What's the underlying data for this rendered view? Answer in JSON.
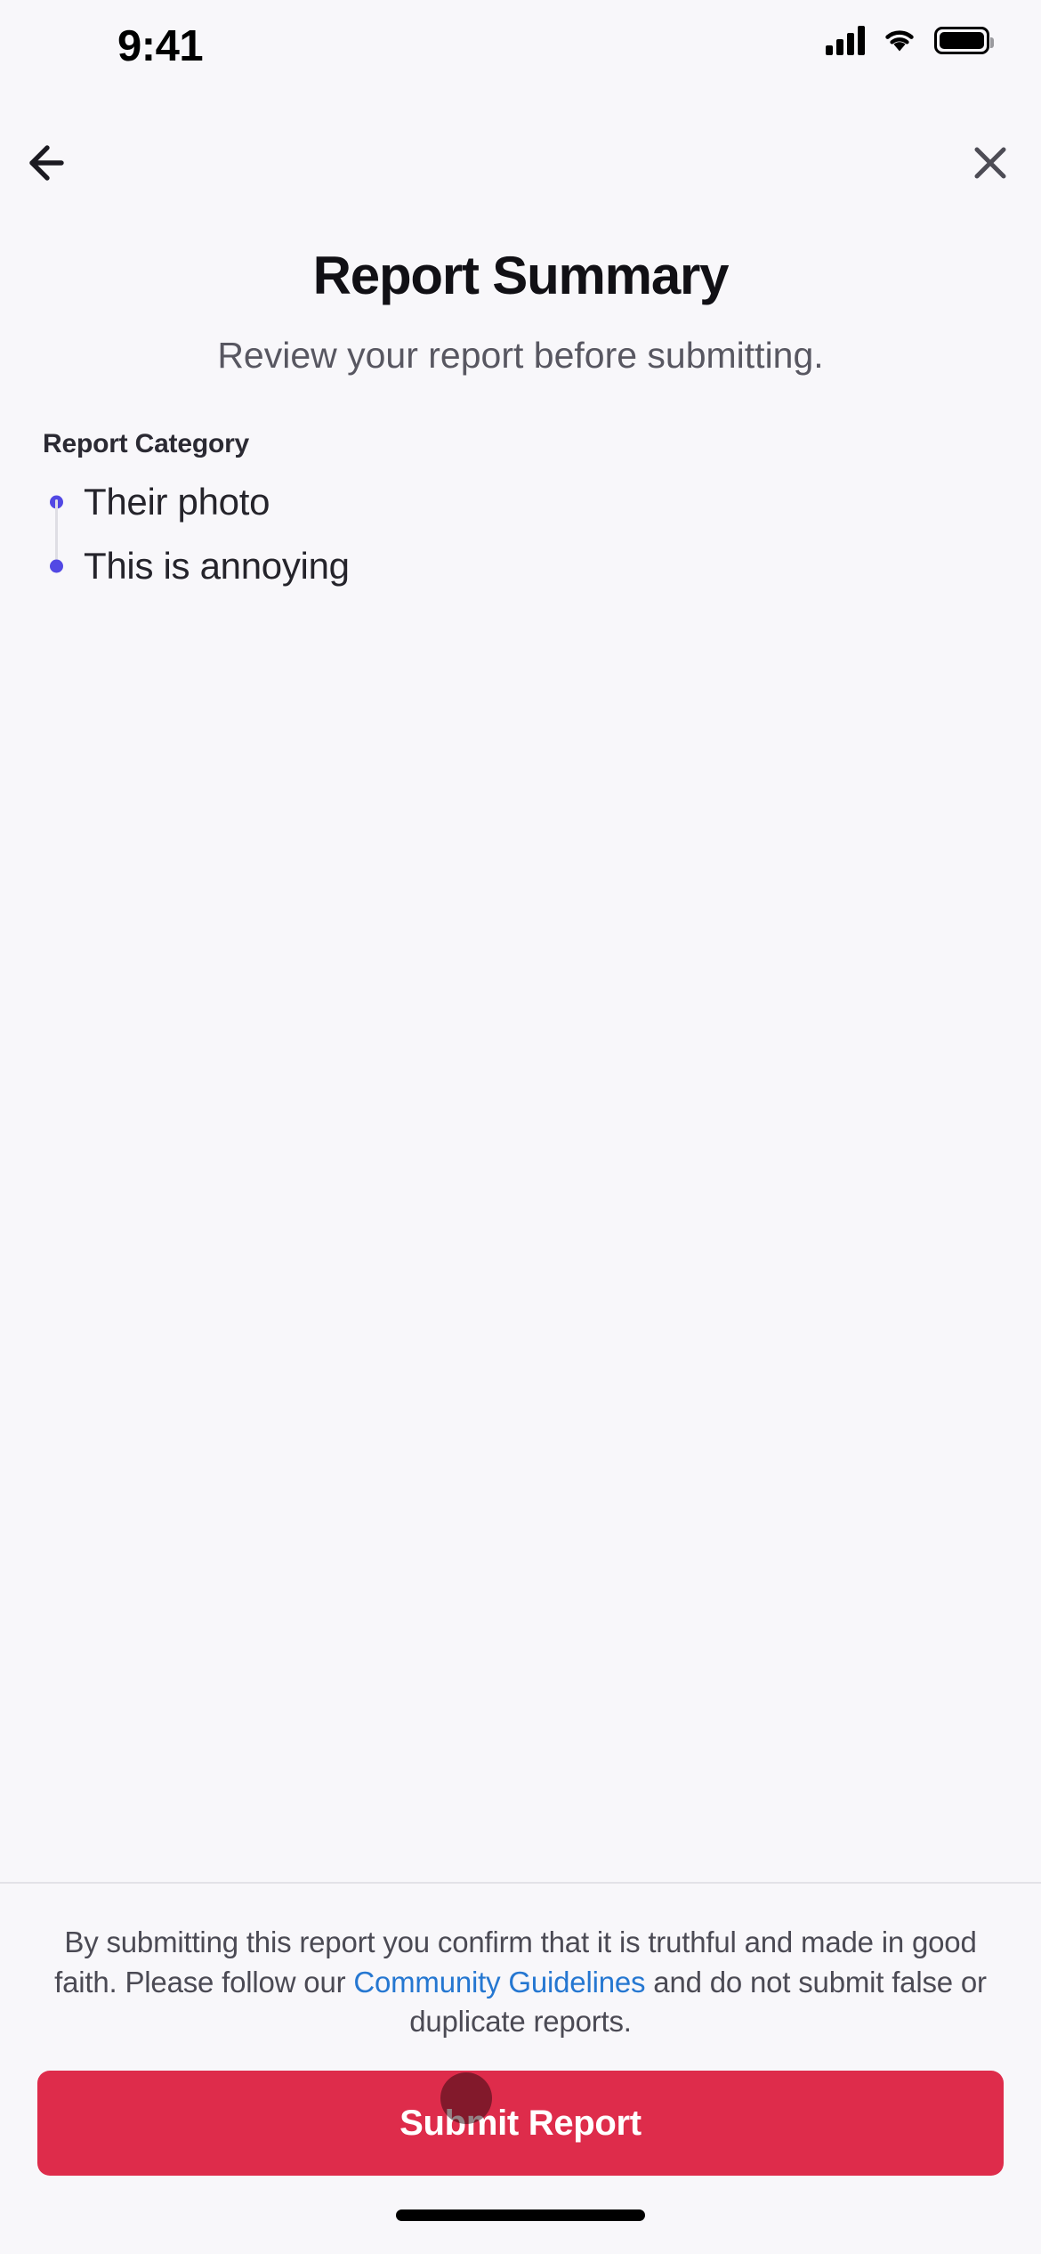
{
  "status_bar": {
    "time": "9:41",
    "signal_icon": "cellular-signal-icon",
    "wifi_icon": "wifi-icon",
    "battery_icon": "battery-full-icon"
  },
  "nav": {
    "back_icon": "arrow-left-icon",
    "close_icon": "close-x-icon"
  },
  "header": {
    "title": "Report Summary",
    "subtitle": "Review your report before submitting."
  },
  "summary": {
    "section_label": "Report Category",
    "items": [
      {
        "label": "Their photo"
      },
      {
        "label": "This is annoying"
      }
    ]
  },
  "footer": {
    "disclaimer_part1": "By submitting this report you confirm that it is truthful and made in good faith. Please follow our ",
    "disclaimer_link": "Community Guidelines",
    "disclaimer_part2": " and do not submit false or duplicate reports.",
    "submit_label": "Submit Report"
  },
  "colors": {
    "background": "#F8F7FA",
    "bullet": "#5248E4",
    "submit_button": "#DE2C4B",
    "link": "#2577D1",
    "title": "#111015",
    "subtitle": "#585761",
    "divider": "#E3E2E7"
  },
  "home_indicator": "home-indicator-bar"
}
